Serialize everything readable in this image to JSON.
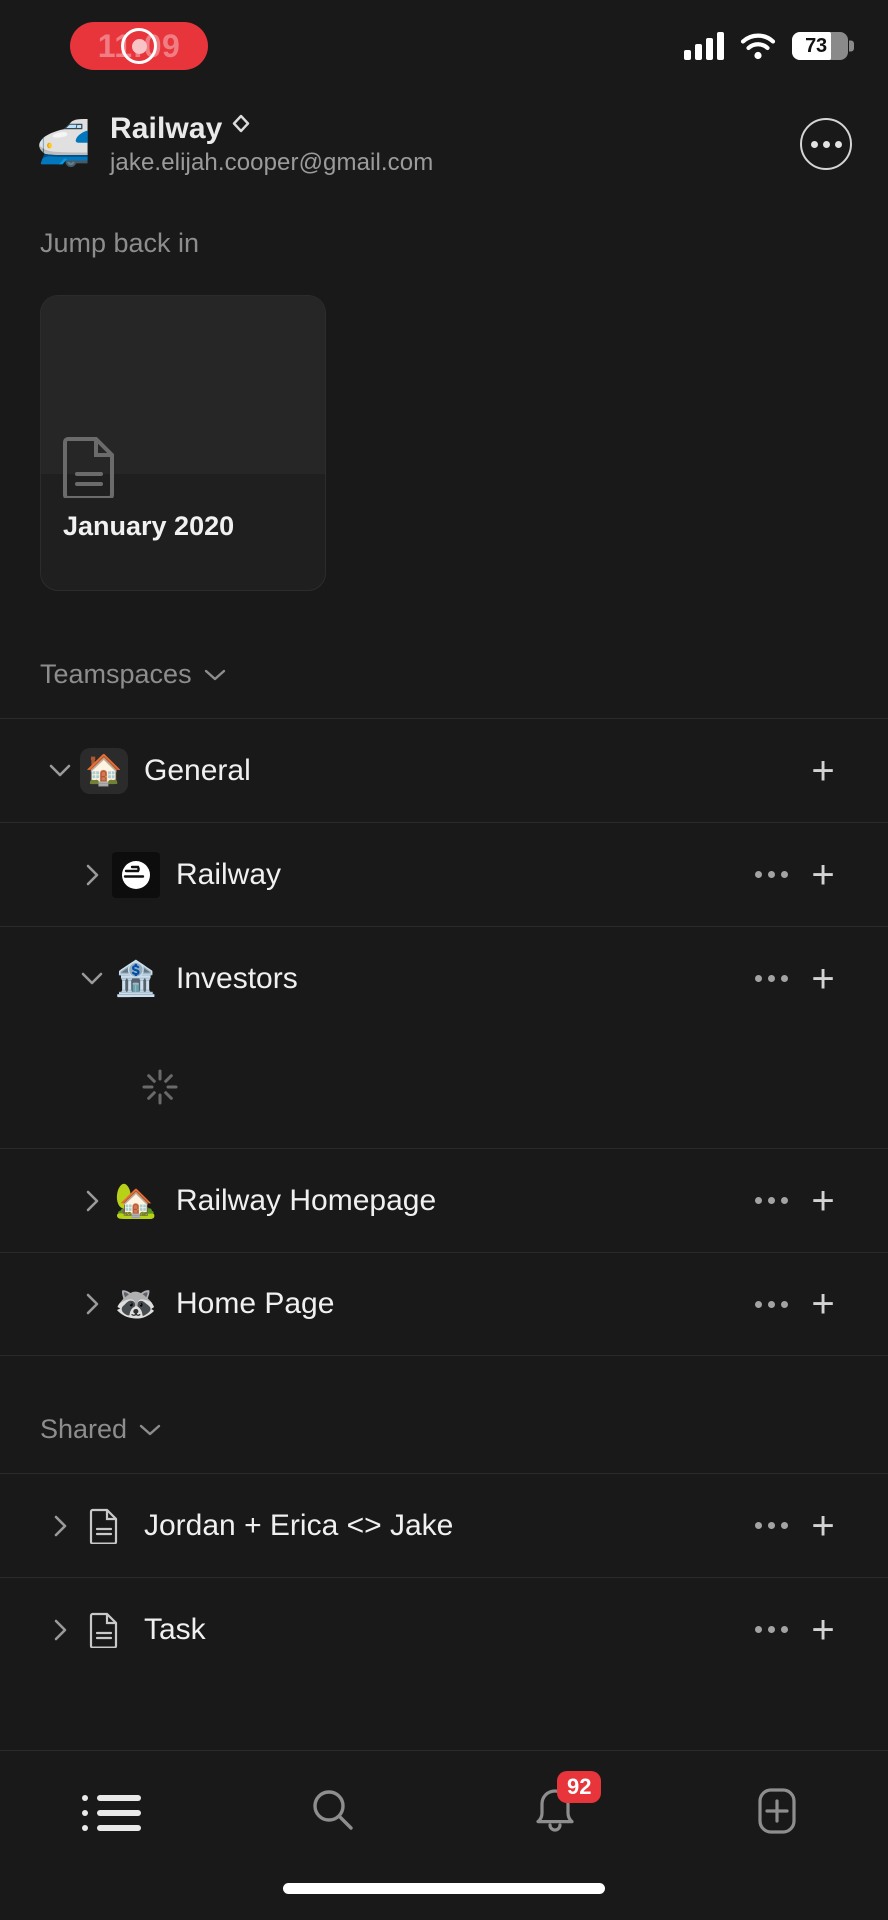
{
  "status_bar": {
    "time": "11:09",
    "recording_icon": "record-indicator",
    "signal_icon": "cellular-signal-icon",
    "wifi_icon": "wifi-icon",
    "battery_level": "73"
  },
  "header": {
    "workspace_emoji": "🚅",
    "workspace_name": "Railway",
    "switcher_icon": "chevron-up-down-icon",
    "account_email": "jake.elijah.cooper@gmail.com",
    "more_icon": "ellipsis-circle-icon"
  },
  "jump_back_in": {
    "label": "Jump back in",
    "cards": [
      {
        "title": "January 2020",
        "icon": "document-icon"
      }
    ]
  },
  "teamspaces": {
    "label": "Teamspaces",
    "collapse_icon": "chevron-down-icon",
    "items": [
      {
        "label": "General",
        "emoji": "🏠",
        "icon_style": "box",
        "twisty": "▾",
        "expanded": true,
        "indent": false,
        "has_dots": false,
        "has_plus": true
      },
      {
        "label": "Railway",
        "emoji": "",
        "icon_style": "logo",
        "twisty": "›",
        "expanded": false,
        "indent": true,
        "has_dots": true,
        "has_plus": true
      },
      {
        "label": "Investors",
        "emoji": "🏦",
        "icon_style": "emoji",
        "twisty": "▾",
        "expanded": true,
        "indent": true,
        "has_dots": true,
        "has_plus": true
      },
      {
        "label": "Railway Homepage",
        "emoji": "🏡",
        "icon_style": "emoji",
        "twisty": "›",
        "expanded": false,
        "indent": true,
        "has_dots": true,
        "has_plus": true
      },
      {
        "label": "Home Page",
        "emoji": "🦝",
        "icon_style": "emoji",
        "twisty": "›",
        "expanded": false,
        "indent": true,
        "has_dots": true,
        "has_plus": true
      }
    ],
    "loading_indicator": "loading-spinner"
  },
  "shared": {
    "label": "Shared",
    "collapse_icon": "chevron-down-icon",
    "items": [
      {
        "label": "Jordan + Erica <> Jake",
        "emoji": "",
        "icon_style": "doc",
        "twisty": "›",
        "has_dots": true,
        "has_plus": true
      },
      {
        "label": "Task",
        "emoji": "",
        "icon_style": "doc",
        "twisty": "›",
        "has_dots": true,
        "has_plus": true
      }
    ]
  },
  "tab_bar": {
    "tabs": [
      {
        "name": "home-tab",
        "icon": "bulleted-list-icon",
        "active": true,
        "badge": ""
      },
      {
        "name": "search-tab",
        "icon": "search-icon",
        "active": false,
        "badge": ""
      },
      {
        "name": "inbox-tab",
        "icon": "bell-icon",
        "active": false,
        "badge": "92"
      },
      {
        "name": "new-page-tab",
        "icon": "plus-square-icon",
        "active": false,
        "badge": ""
      }
    ]
  },
  "colors": {
    "background": "#191919",
    "accent_red": "#e8353c",
    "divider": "#2a2a2a",
    "text_primary": "#f0f0f0",
    "text_secondary": "#8d8d8d"
  }
}
